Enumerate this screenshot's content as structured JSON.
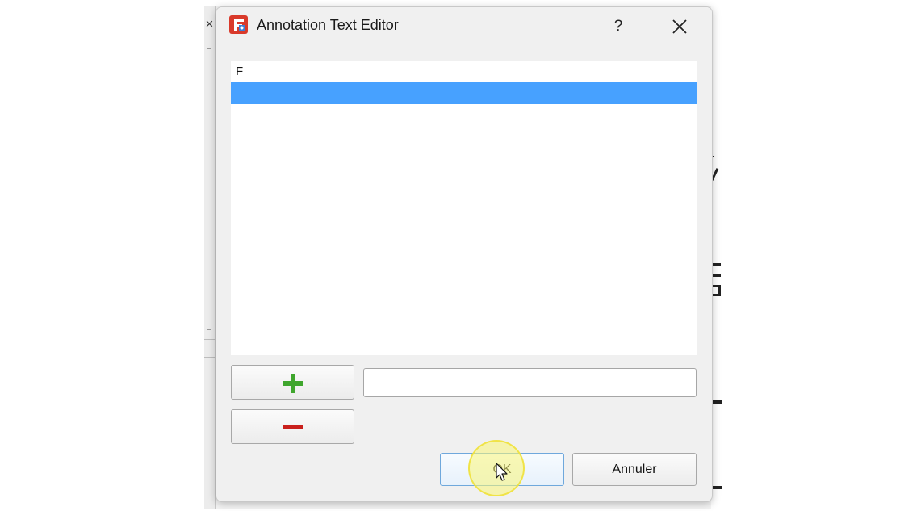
{
  "window": {
    "title": "Annotation Text Editor",
    "help_label": "?",
    "close_icon": "close-icon",
    "app_icon": "freecad-icon"
  },
  "list": {
    "items": [
      "F",
      ""
    ],
    "selected_index": 1
  },
  "controls": {
    "add_icon": "plus-icon",
    "remove_icon": "minus-icon",
    "text_field_value": ""
  },
  "buttons": {
    "ok_label": "OK",
    "cancel_label": "Annuler"
  },
  "colors": {
    "selection": "#47a1ff",
    "add": "#3fa62d",
    "remove": "#c9201c",
    "ok_border": "#6fa8dc",
    "click_highlight": "#faf578"
  }
}
